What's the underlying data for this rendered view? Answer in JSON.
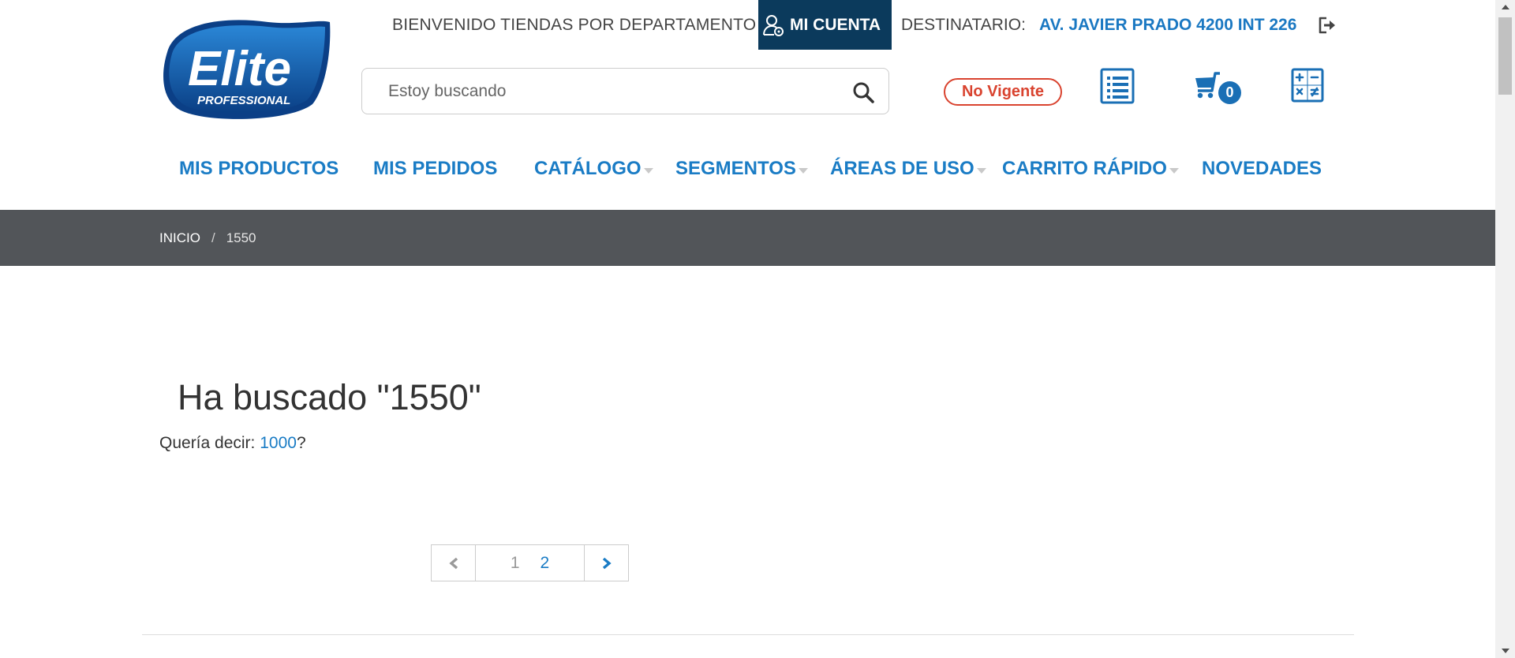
{
  "logo": {
    "brand": "Elite",
    "sub": "PROFESSIONAL"
  },
  "topbar": {
    "welcome": "BIENVENIDO TIENDAS POR DEPARTAMENTO",
    "account_label": "MI CUENTA",
    "recipient_label": "DESTINATARIO:",
    "recipient_value": "AV. JAVIER PRADO 4200 INT 226"
  },
  "search": {
    "placeholder": "Estoy buscando",
    "value": ""
  },
  "status": {
    "label": "No Vigente",
    "color": "#d9432f"
  },
  "cart": {
    "count": "0"
  },
  "icons": [
    "logout-icon",
    "search-icon",
    "list-icon",
    "cart-icon",
    "calculator-icon"
  ],
  "nav": {
    "items": [
      {
        "label": "MIS PRODUCTOS",
        "dropdown": false
      },
      {
        "label": "MIS PEDIDOS",
        "dropdown": false
      },
      {
        "label": "CATÁLOGO",
        "dropdown": true
      },
      {
        "label": "SEGMENTOS",
        "dropdown": true
      },
      {
        "label": "ÁREAS DE USO",
        "dropdown": true
      },
      {
        "label": "CARRITO RÁPIDO",
        "dropdown": true
      },
      {
        "label": "NOVEDADES",
        "dropdown": false
      }
    ]
  },
  "breadcrumb": {
    "home": "INICIO",
    "separator": "/",
    "current": "1550"
  },
  "main": {
    "title": "Ha buscado \"1550\"",
    "suggest_prefix": "Quería decir: ",
    "suggest_link": "1000",
    "suggest_suffix": "?"
  },
  "pagination": {
    "pages": [
      "1",
      "2"
    ],
    "current": "1"
  },
  "colors": {
    "accent": "#1a7cc5",
    "account_bg": "#0b3a5c",
    "crumb_bg": "#525559",
    "logo_blue": "#0d5aa7"
  }
}
